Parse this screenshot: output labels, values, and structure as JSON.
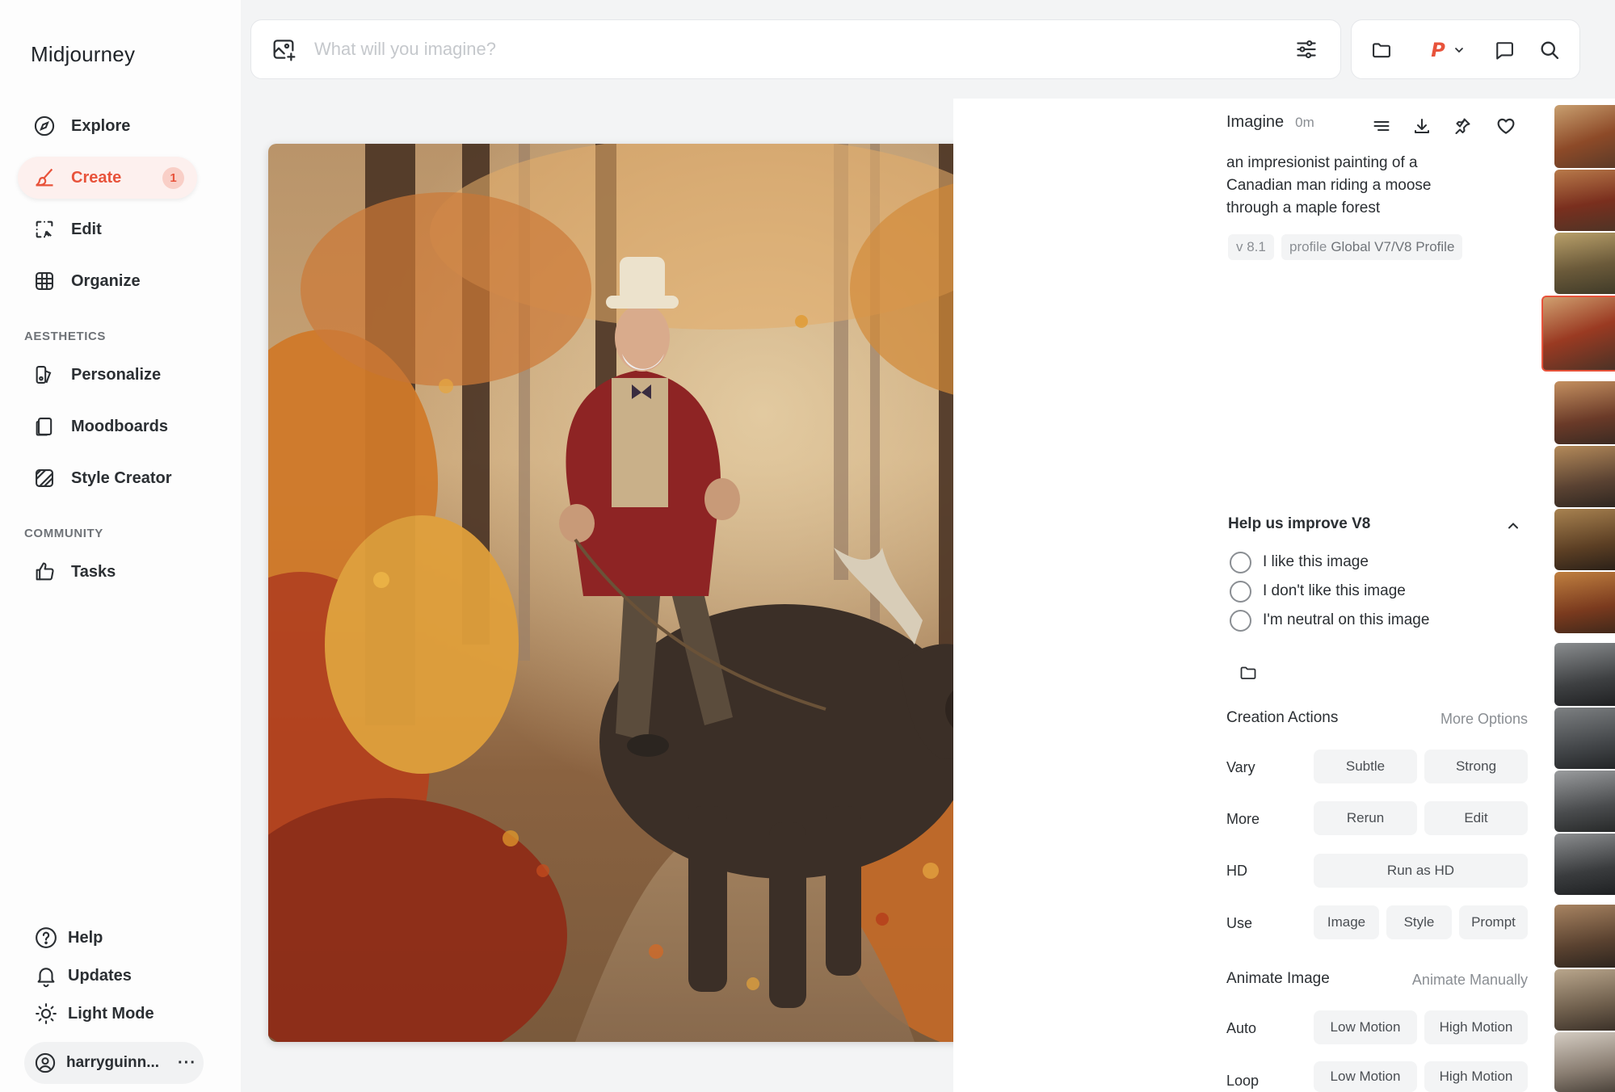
{
  "app": {
    "name": "Midjourney"
  },
  "sidebar": {
    "nav": [
      {
        "label": "Explore",
        "icon": "compass-icon"
      },
      {
        "label": "Create",
        "icon": "brush-icon",
        "badge": "1",
        "active": true
      },
      {
        "label": "Edit",
        "icon": "edit-frame-icon"
      },
      {
        "label": "Organize",
        "icon": "grid-icon"
      }
    ],
    "aesthetics_label": "AESTHETICS",
    "aesthetics": [
      {
        "label": "Personalize",
        "icon": "personalize-icon"
      },
      {
        "label": "Moodboards",
        "icon": "moodboard-icon"
      },
      {
        "label": "Style Creator",
        "icon": "style-creator-icon"
      }
    ],
    "community_label": "COMMUNITY",
    "community": [
      {
        "label": "Tasks",
        "icon": "thumbs-up-icon"
      }
    ],
    "bottom": [
      {
        "label": "Help",
        "icon": "help-icon"
      },
      {
        "label": "Updates",
        "icon": "bell-icon"
      },
      {
        "label": "Light Mode",
        "icon": "sun-icon"
      }
    ],
    "user": {
      "name": "harryguinn...",
      "more": "···"
    }
  },
  "search": {
    "placeholder": "What will you imagine?"
  },
  "toolbar": {
    "profile_letter": "P"
  },
  "detail": {
    "kind": "Imagine",
    "time": "0m",
    "prompt": "an impresionist painting of a Canadian man riding a moose through a maple forest",
    "version_chip": "v 8.1",
    "profile_prefix": "profile",
    "profile_value": "Global V7/V8 Profile",
    "help": {
      "title": "Help us improve V8",
      "options": [
        "I like this image",
        "I don't like this image",
        "I'm neutral on this image"
      ]
    },
    "creation_actions": {
      "title": "Creation Actions",
      "link": "More Options",
      "vary_label": "Vary",
      "vary_subtle": "Subtle",
      "vary_strong": "Strong",
      "more_label": "More",
      "rerun": "Rerun",
      "edit": "Edit",
      "hd_label": "HD",
      "run_hd": "Run as HD",
      "use_label": "Use",
      "use_image": "Image",
      "use_style": "Style",
      "use_prompt": "Prompt"
    },
    "animate": {
      "title": "Animate Image",
      "link": "Animate Manually",
      "auto_label": "Auto",
      "auto_low": "Low Motion",
      "auto_high": "High Motion",
      "loop_label": "Loop",
      "loop_low": "Low Motion",
      "loop_high": "High Motion"
    }
  },
  "colors": {
    "accent": "#e8533b",
    "accent_bg": "#fdf0ee",
    "muted": "#8a8e93",
    "surface": "#f3f4f5"
  }
}
